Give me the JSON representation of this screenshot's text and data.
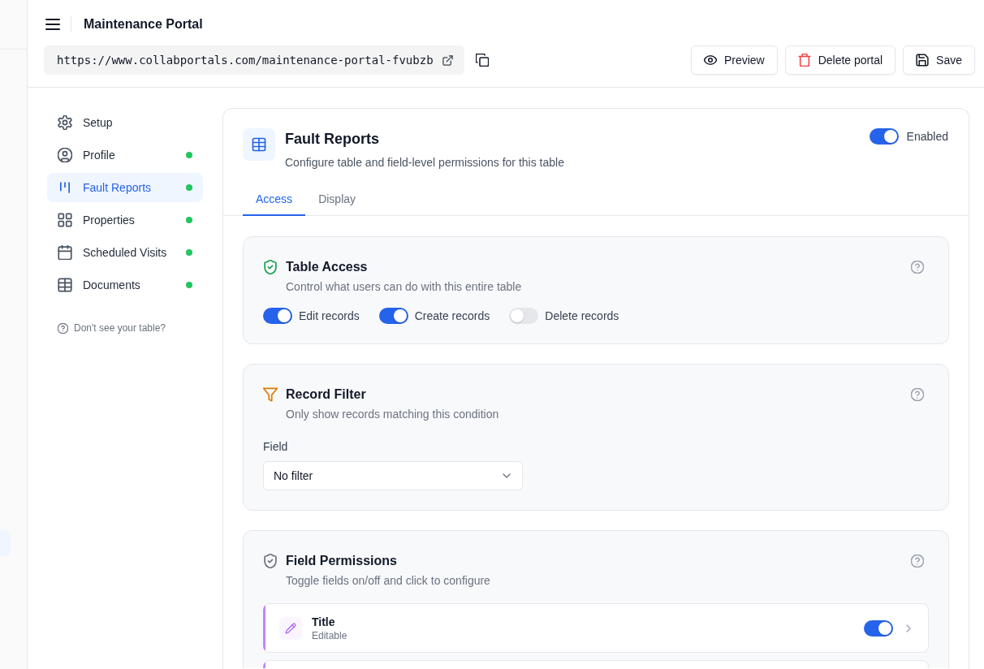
{
  "header": {
    "title": "Maintenance Portal",
    "url": "https://www.collabportals.com/maintenance-portal-fvubzb",
    "buttons": [
      {
        "label": "Preview",
        "kind": "preview"
      },
      {
        "label": "Delete portal",
        "kind": "delete"
      },
      {
        "label": "Save",
        "kind": "save"
      }
    ]
  },
  "sidebar": {
    "items": [
      {
        "label": "Setup",
        "selected": false,
        "complete": false
      },
      {
        "label": "Profile",
        "selected": false,
        "complete": true
      },
      {
        "label": "Fault Reports",
        "selected": true,
        "complete": true
      },
      {
        "label": "Properties",
        "selected": false,
        "complete": true
      },
      {
        "label": "Scheduled Visits",
        "selected": false,
        "complete": true
      },
      {
        "label": "Documents",
        "selected": false,
        "complete": true
      }
    ],
    "help": "Don't see your table?"
  },
  "table": {
    "title": "Fault Reports",
    "subtitle": "Configure table and field-level permissions for this table",
    "enabled": {
      "label": "Enabled",
      "on": true
    },
    "tabs": [
      {
        "label": "Access",
        "selected": true
      },
      {
        "label": "Display",
        "selected": false
      }
    ]
  },
  "sections": [
    {
      "kind": "toggles",
      "title": "Table Access",
      "subtitle": "Control what users can do with this entire table",
      "toggles": [
        {
          "label": "Edit records",
          "on": true
        },
        {
          "label": "Create records",
          "on": true
        },
        {
          "label": "Delete records",
          "on": false
        }
      ]
    },
    {
      "kind": "filter",
      "title": "Record Filter",
      "subtitle": "Only show records matching this condition",
      "field_label": "Field",
      "select": {
        "value": "No filter"
      }
    },
    {
      "kind": "fields",
      "title": "Field Permissions",
      "subtitle": "Toggle fields on/off and click to configure",
      "fields": [
        {
          "name": "Title",
          "access": "Editable",
          "on": true,
          "color": "#c084fc"
        }
      ]
    }
  ]
}
